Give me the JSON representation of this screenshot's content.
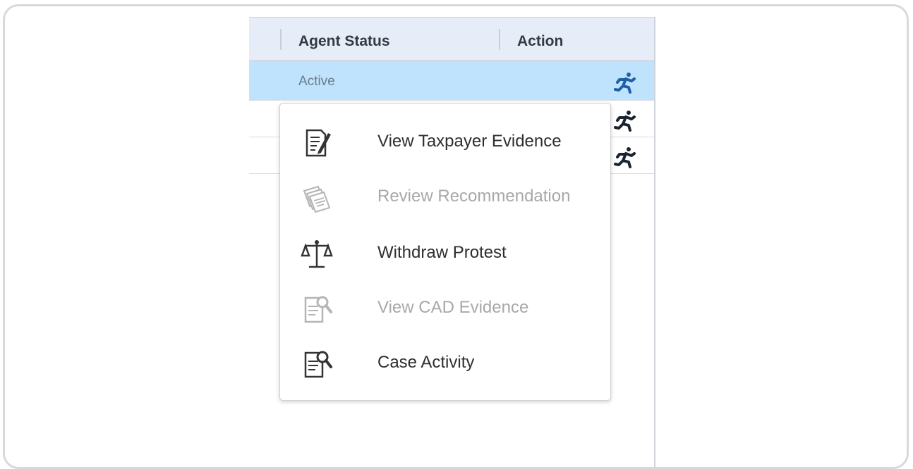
{
  "grid": {
    "columns": [
      {
        "label": "Agent Status"
      },
      {
        "label": "Action"
      }
    ],
    "rows": [
      {
        "agent_status": "Active",
        "selected": true
      },
      {
        "agent_status": "",
        "selected": false
      },
      {
        "agent_status": "",
        "selected": false
      }
    ],
    "colors": {
      "header_bg": "#e6edf8",
      "selected_row": "#bfe3fc",
      "action_icon": "#1f5fa8"
    }
  },
  "menu": {
    "items": [
      {
        "label": "View Taxpayer Evidence",
        "icon": "document-edit-icon",
        "enabled": true
      },
      {
        "label": "Review Recommendation",
        "icon": "documents-stack-icon",
        "enabled": false
      },
      {
        "label": "Withdraw Protest",
        "icon": "scales-icon",
        "enabled": true
      },
      {
        "label": "View CAD Evidence",
        "icon": "document-search-icon",
        "enabled": false
      },
      {
        "label": "Case Activity",
        "icon": "document-search-icon",
        "enabled": true
      }
    ]
  }
}
